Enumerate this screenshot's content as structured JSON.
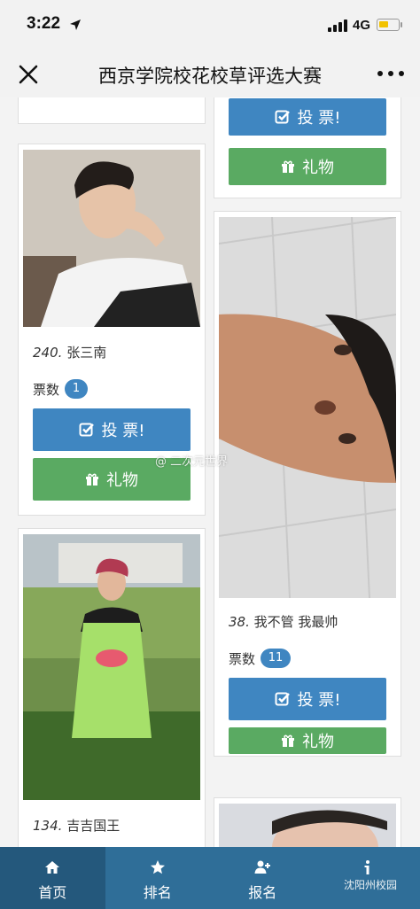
{
  "status_bar": {
    "time": "3:22",
    "network": "4G"
  },
  "nav": {
    "title": "西京学院校花校草评选大赛"
  },
  "buttons": {
    "vote_label": "投 票!",
    "gift_label": "礼物"
  },
  "votes_label": "票数",
  "contestants": [
    {
      "number": "240.",
      "name": "张三南",
      "votes": "1"
    },
    {
      "number": "38.",
      "name": "我不管 我最帅",
      "votes": "11"
    },
    {
      "number": "134.",
      "name": "吉吉国王"
    }
  ],
  "watermark": "@ 二次元世界",
  "corner_mark": "沈阳州校园",
  "tabs": [
    {
      "label": "首页",
      "icon": "home-icon"
    },
    {
      "label": "排名",
      "icon": "star-icon"
    },
    {
      "label": "报名",
      "icon": "add-user-icon"
    },
    {
      "label": "",
      "icon": "info-icon"
    }
  ],
  "colors": {
    "vote": "#3f86c1",
    "gift": "#5aaa62",
    "tab_bar": "#2f6e98"
  }
}
